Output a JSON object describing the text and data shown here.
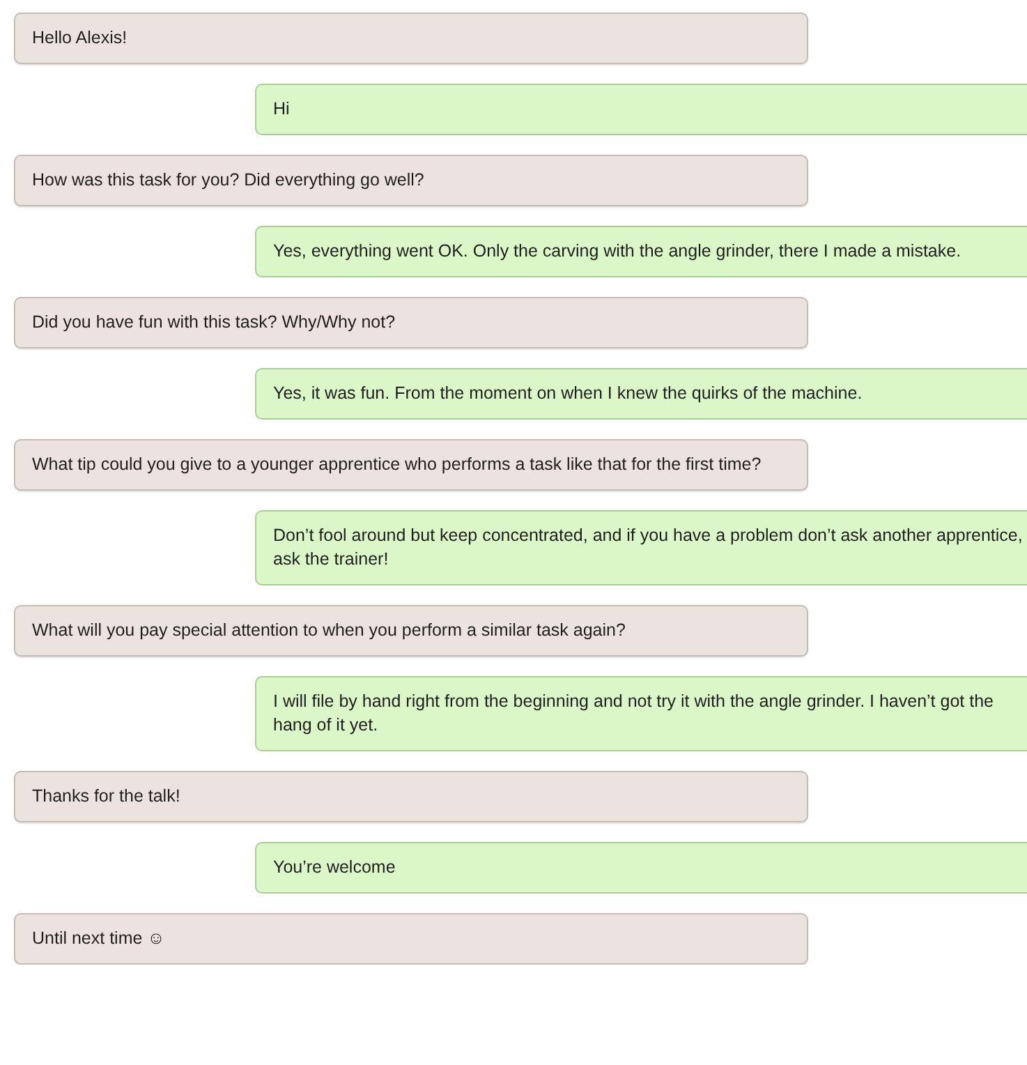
{
  "messages": [
    {
      "kind": "received",
      "text": "Hello Alexis!"
    },
    {
      "kind": "sent",
      "text": "Hi"
    },
    {
      "kind": "received",
      "text": "How was this task for you? Did everything go well?"
    },
    {
      "kind": "sent",
      "text": "Yes, everything went OK. Only the carving with the angle grinder, there I made a mistake."
    },
    {
      "kind": "received",
      "text": "Did you have fun with this task? Why/Why not?"
    },
    {
      "kind": "sent",
      "text": "Yes, it was fun. From the moment on when I knew the quirks of the machine."
    },
    {
      "kind": "received",
      "text": "What tip could you give to a younger apprentice who performs a task like that for the first time?"
    },
    {
      "kind": "sent",
      "text": "Don’t fool around but keep concentrated, and if you have a problem don’t ask another apprentice, ask the trainer!"
    },
    {
      "kind": "received",
      "text": "What will you pay special attention to when you perform a similar task again?"
    },
    {
      "kind": "sent",
      "text": "I will file by hand right from the beginning and not try it with the angle grinder. I haven’t got the hang of it yet."
    },
    {
      "kind": "received",
      "text": "Thanks for the talk!"
    },
    {
      "kind": "sent",
      "text": "You’re welcome"
    },
    {
      "kind": "received",
      "text": "Until next time ☺"
    }
  ]
}
